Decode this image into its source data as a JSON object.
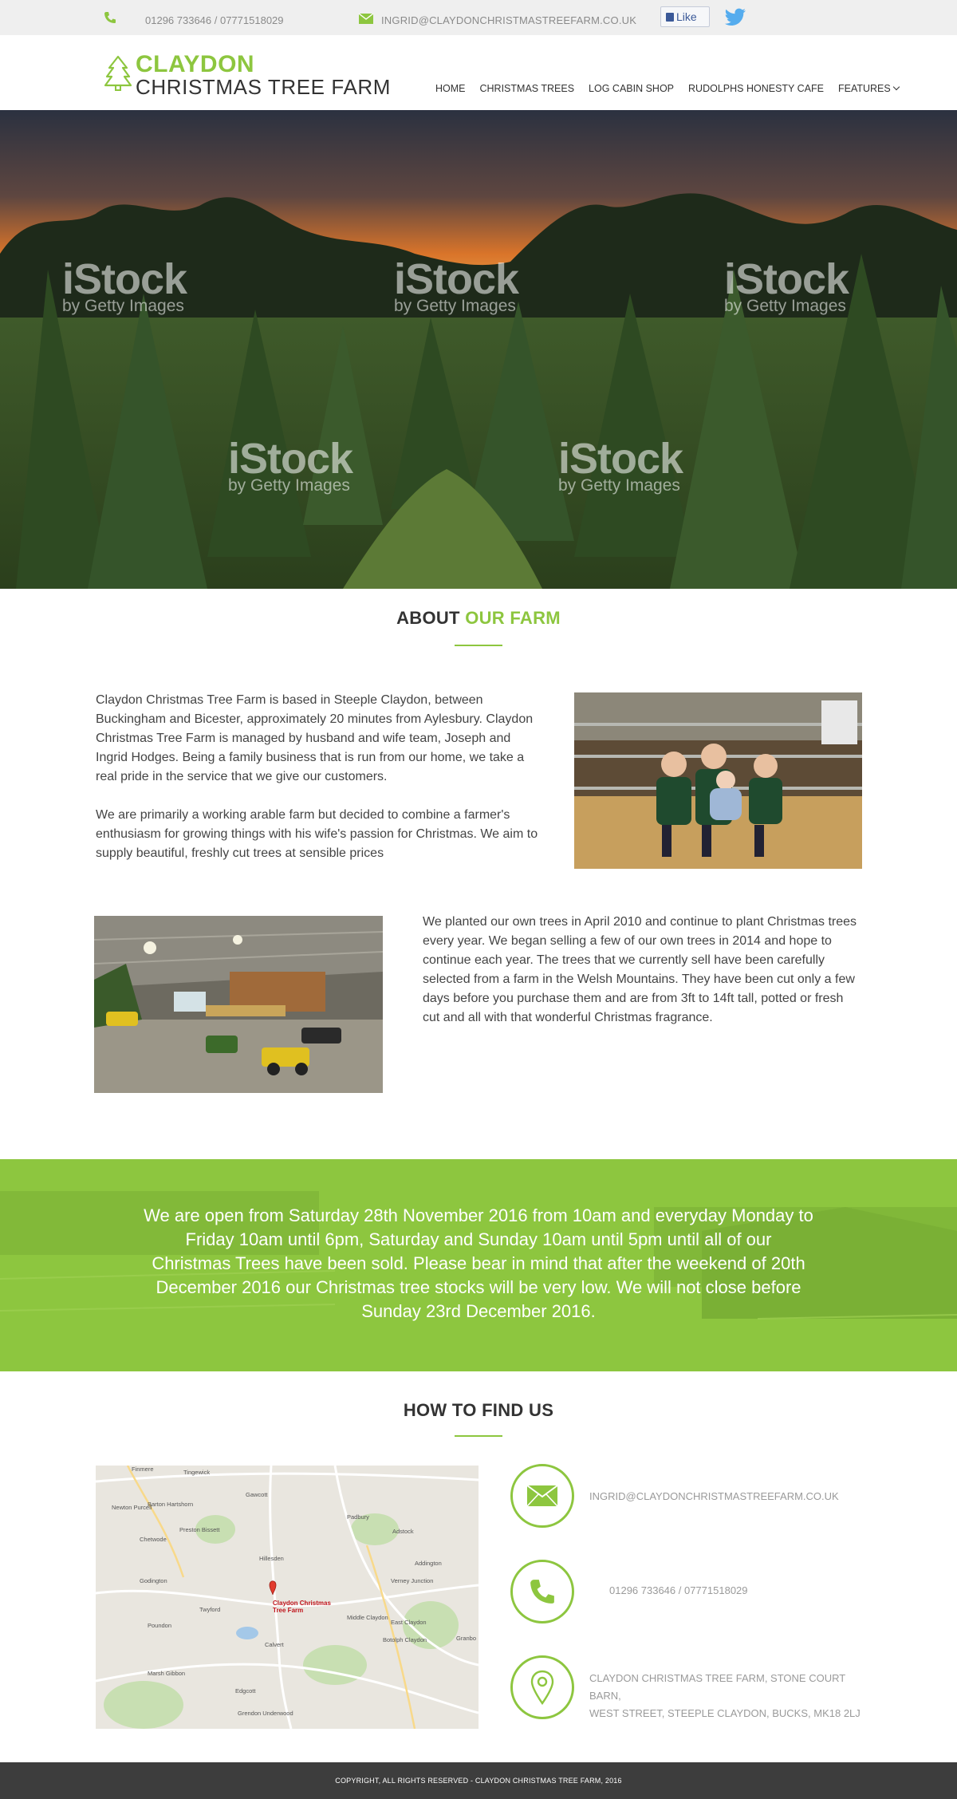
{
  "topbar": {
    "phone": "01296 733646 / 07771518029",
    "email": "INGRID@CLAYDONCHRISTMASTREEFARM.CO.UK",
    "like_label": "Like",
    "icons": [
      "phone-icon",
      "mail-icon",
      "thumbs-up-icon",
      "twitter-icon"
    ]
  },
  "logo": {
    "line1": "CLAYDON",
    "line2": "CHRISTMAS TREE FARM"
  },
  "nav": {
    "items": [
      {
        "label": "HOME"
      },
      {
        "label": "CHRISTMAS TREES"
      },
      {
        "label": "LOG CABIN SHOP"
      },
      {
        "label": "RUDOLPHS HONESTY CAFE"
      },
      {
        "label": "FEATURES"
      }
    ]
  },
  "hero": {
    "watermark_main": "iStock",
    "watermark_sub": "by Getty Images"
  },
  "about": {
    "title_plain": "ABOUT ",
    "title_highlight": "OUR FARM",
    "para1": "Claydon Christmas Tree Farm is based in Steeple Claydon, between Buckingham and Bicester, approximately 20 minutes from Aylesbury. Claydon Christmas Tree Farm is managed by husband and wife team, Joseph and Ingrid Hodges.  Being a family business that is run from our home, we take a real pride in the service that we give our customers.",
    "para2": "We are primarily a working arable farm but decided to combine a farmer's enthusiasm for growing things with his wife's passion for Christmas.  We aim to supply beautiful, freshly cut trees at sensible prices",
    "para3": "We planted our own trees in April 2010 and continue to plant Christmas trees every year.  We began selling a few of our own trees in 2014 and hope to continue each year.  The trees that we currently sell have been carefully selected from a farm in the Welsh Mountains.  They have been cut only a few days before you purchase them and are from 3ft to 14ft tall, potted or fresh cut and all with that wonderful Christmas fragrance."
  },
  "banner": {
    "text": "We are open from Saturday 28th November 2016 from 10am and everyday Monday to Friday 10am until 6pm, Saturday and Sunday 10am until 5pm until all of our Christmas Trees have been sold.  Please bear in mind that after the weekend of 20th December 2016 our Christmas tree stocks will be very low.  We will not close before Sunday 23rd December 2016."
  },
  "find_us": {
    "title": "HOW TO FIND US",
    "email": "INGRID@CLAYDONCHRISTMASTREEFARM.CO.UK",
    "phone": "01296 733646 / 07771518029",
    "address_line1": "CLAYDON CHRISTMAS TREE FARM, STONE COURT BARN,",
    "address_line2": "WEST STREET, STEEPLE CLAYDON, BUCKS, MK18 2LJ",
    "map": {
      "pin_label_line1": "Claydon Christmas",
      "pin_label_line2": "Tree Farm",
      "towns": [
        "Finmere",
        "Tingewick",
        "Newton Purcell",
        "Barton Hartshorn",
        "Gawcott",
        "Chetwode",
        "Preston Bissett",
        "Padbury",
        "Adstock",
        "Hillesden",
        "Addington",
        "Godington",
        "Verney Junction",
        "Twyford",
        "Middle Claydon",
        "East Claydon",
        "Poundon",
        "Calvert",
        "Botolph Claydon",
        "Granbo",
        "Marsh Gibbon",
        "Edgcott",
        "Grendon Underwood"
      ]
    }
  },
  "footer": {
    "text": "COPYRIGHT, ALL RIGHTS RESERVED - CLAYDON CHRISTMAS TREE FARM, 2016"
  },
  "colors": {
    "accent": "#8dc63f",
    "footer_bg": "#3d3d3d",
    "topbar_bg": "#efefef"
  }
}
